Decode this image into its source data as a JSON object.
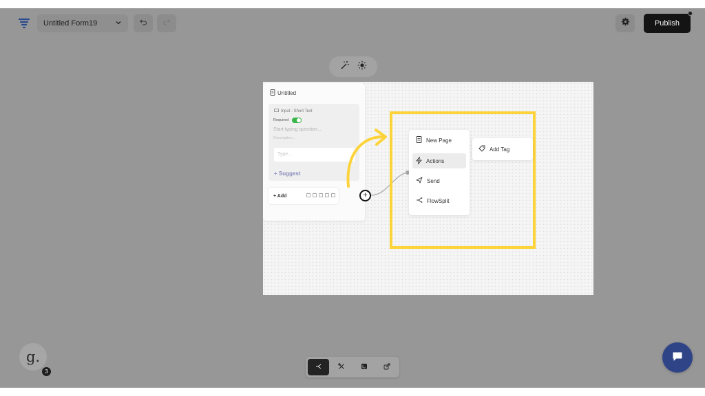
{
  "header": {
    "form_name": "Untitled Form19",
    "publish_label": "Publish",
    "logo_icon": "funnel-logo-icon",
    "undo_icon": "undo-icon",
    "redo_icon": "redo-icon",
    "settings_icon": "gear-icon"
  },
  "floating_toolbar": {
    "magic_icon": "magic-wand-icon",
    "theme_icon": "sun-icon"
  },
  "page_card": {
    "title": "Untitled",
    "question": {
      "type_label": "Input - Short Text",
      "required_label": "Required",
      "required_on": true,
      "question_placeholder": "Start typing question...",
      "description_placeholder": "Description...",
      "answer_placeholder": "Type..."
    },
    "suggest_label": "+ Suggest",
    "add_label": "+ Add"
  },
  "add_menu": {
    "items": [
      {
        "label": "New Page",
        "icon": "page-icon"
      },
      {
        "label": "Actions",
        "icon": "lightning-icon"
      },
      {
        "label": "Send",
        "icon": "send-icon"
      },
      {
        "label": "FlowSplit",
        "icon": "split-icon"
      }
    ],
    "active_index": 1,
    "submenu_label": "Add Tag",
    "highlight_color": "#fdd33a",
    "arrow_color": "#fdd33a"
  },
  "bottom_toolbar": {
    "items": [
      "flow-icon",
      "tools-icon",
      "layout-icon",
      "share-icon"
    ],
    "active_index": 0
  },
  "user": {
    "avatar_letter": "g.",
    "notification_count": "3"
  },
  "chat_icon": "chat-bubble-icon"
}
